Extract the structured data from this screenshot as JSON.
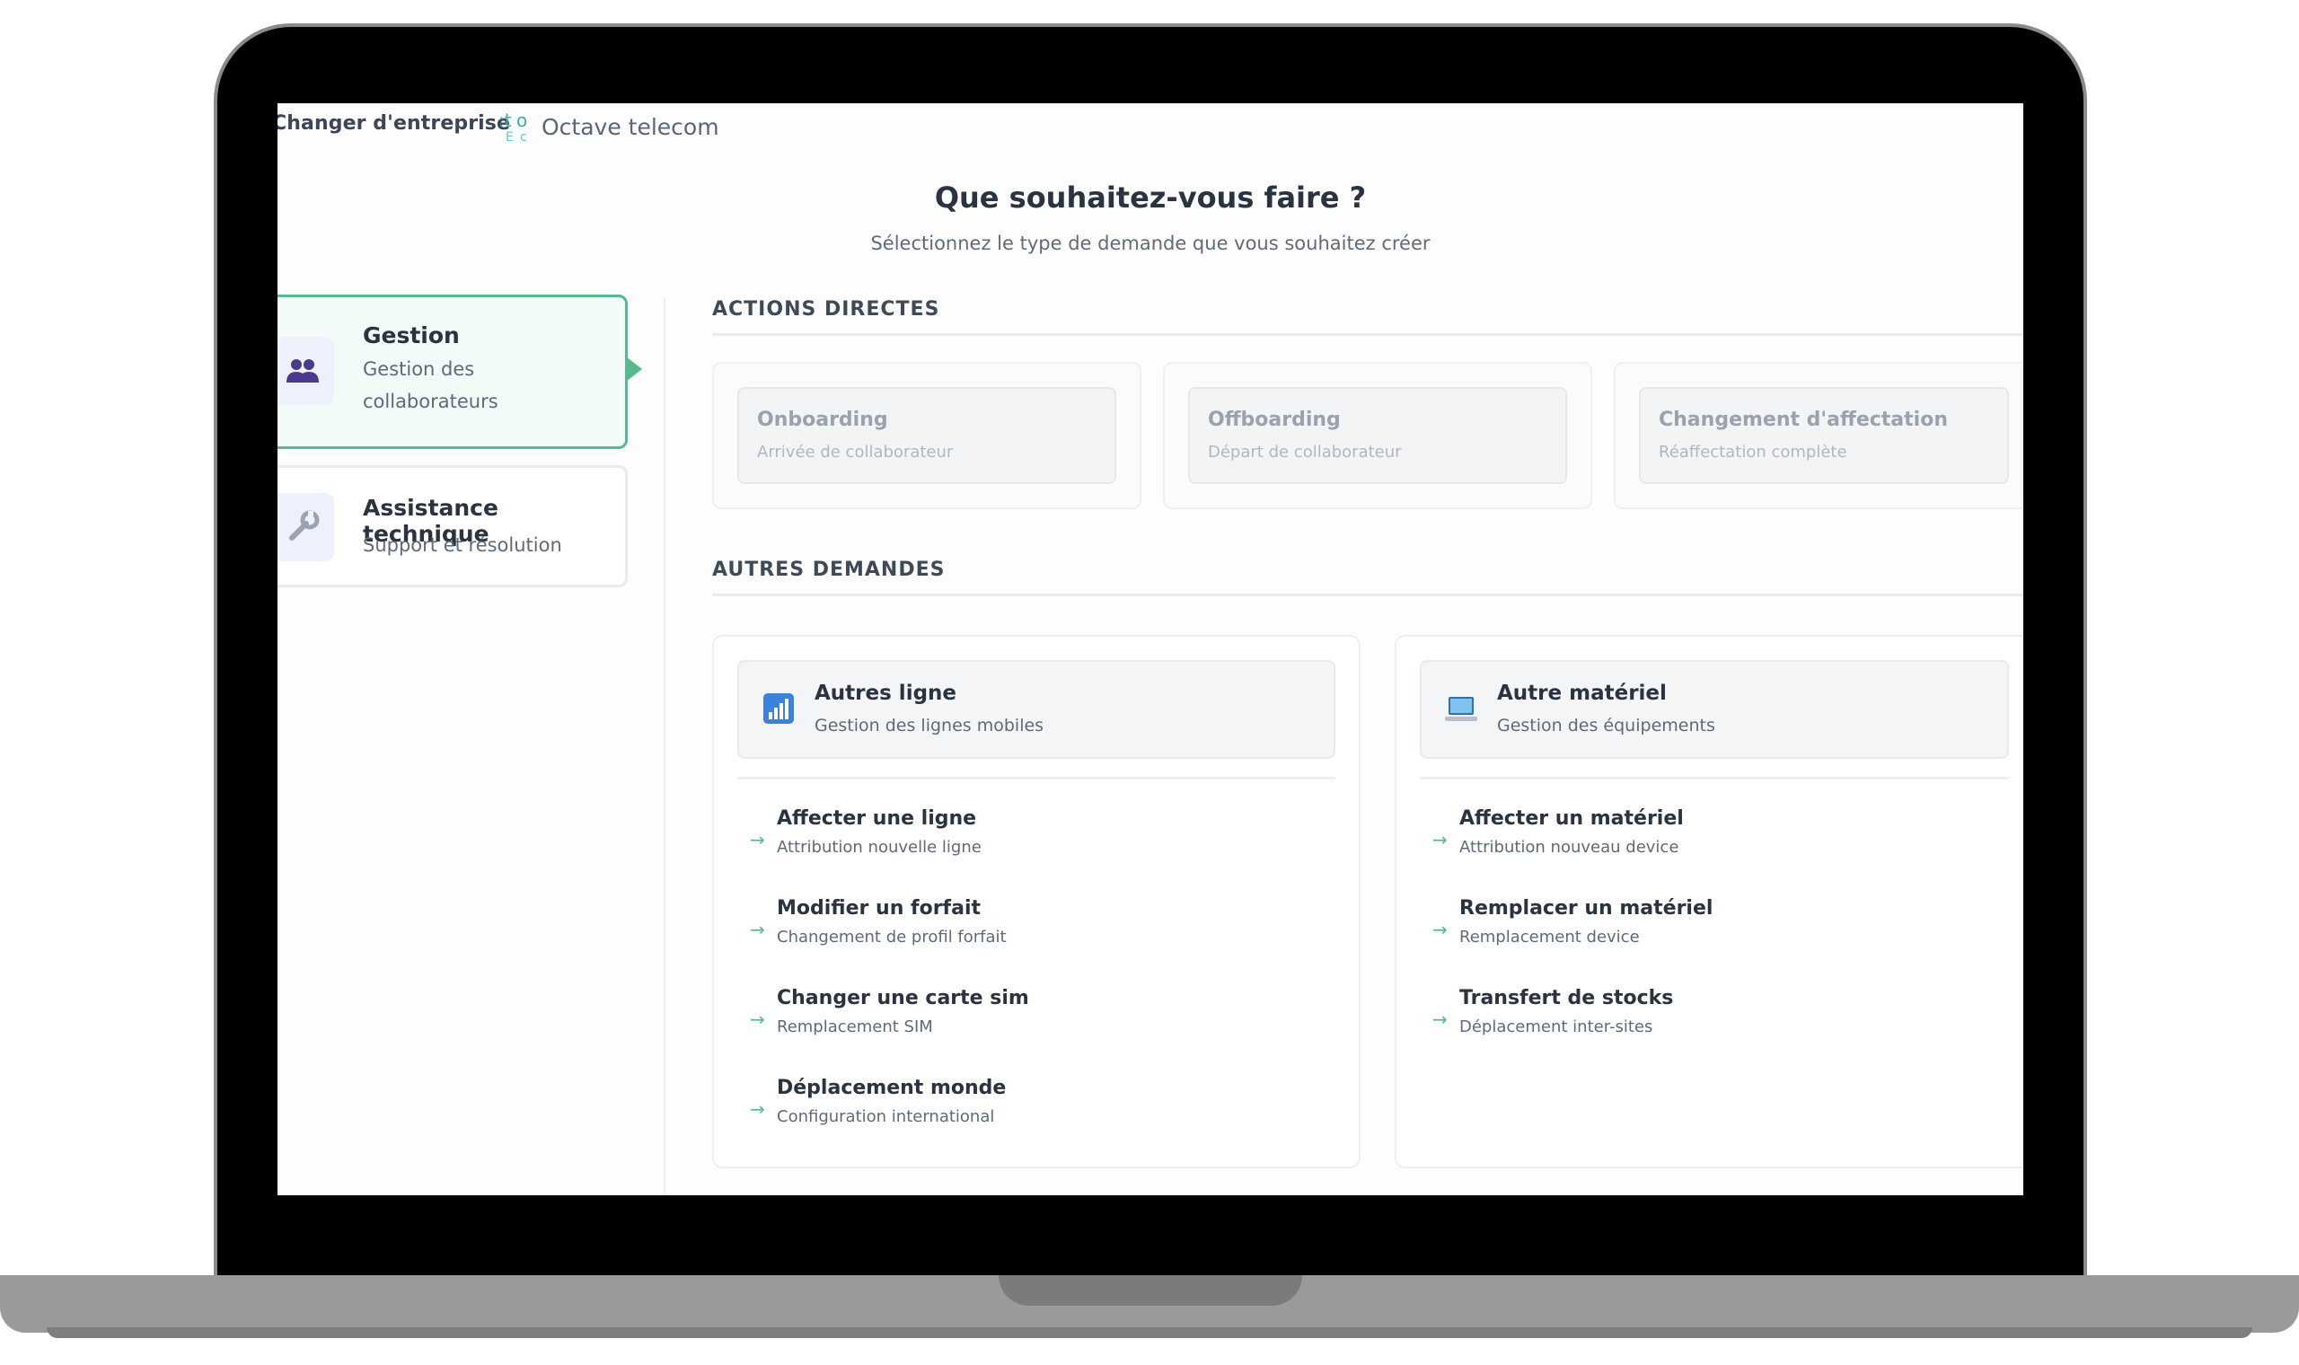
{
  "topbar": {
    "switch_company": "Changer d'entreprise",
    "brand_name": "Octave telecom"
  },
  "header": {
    "title": "Que souhaitez-vous faire ?",
    "subtitle": "Sélectionnez le type de demande que vous souhaitez créer"
  },
  "categories": [
    {
      "title": "Gestion",
      "desc": "Gestion des collaborateurs",
      "icon": "people-icon",
      "active": true
    },
    {
      "title": "Assistance technique",
      "desc": "Support et résolution",
      "icon": "wrench-icon",
      "active": false
    }
  ],
  "direct_actions": {
    "label": "ACTIONS DIRECTES",
    "items": [
      {
        "title": "Onboarding",
        "desc": "Arrivée de collaborateur"
      },
      {
        "title": "Offboarding",
        "desc": "Départ de collaborateur"
      },
      {
        "title": "Changement d'affectation",
        "desc": "Réaffectation complète"
      }
    ]
  },
  "other_requests": {
    "label": "AUTRES DEMANDES",
    "groups": [
      {
        "title": "Autres ligne",
        "desc": "Gestion des lignes mobiles",
        "icon": "bar-chart-icon",
        "items": [
          {
            "title": "Affecter une ligne",
            "desc": "Attribution nouvelle ligne"
          },
          {
            "title": "Modifier un forfait",
            "desc": "Changement de profil forfait"
          },
          {
            "title": "Changer une carte sim",
            "desc": "Remplacement SIM"
          },
          {
            "title": "Déplacement monde",
            "desc": "Configuration international"
          }
        ]
      },
      {
        "title": "Autre matériel",
        "desc": "Gestion des équipements",
        "icon": "laptop-icon",
        "items": [
          {
            "title": "Affecter un matériel",
            "desc": "Attribution nouveau device"
          },
          {
            "title": "Remplacer un matériel",
            "desc": "Remplacement device"
          },
          {
            "title": "Transfert de stocks",
            "desc": "Déplacement inter-sites"
          }
        ]
      }
    ]
  },
  "colors": {
    "accent": "#57b98d",
    "title_text": "#2a3340",
    "muted_text": "#5f6a78"
  },
  "arrow_glyph": "→"
}
